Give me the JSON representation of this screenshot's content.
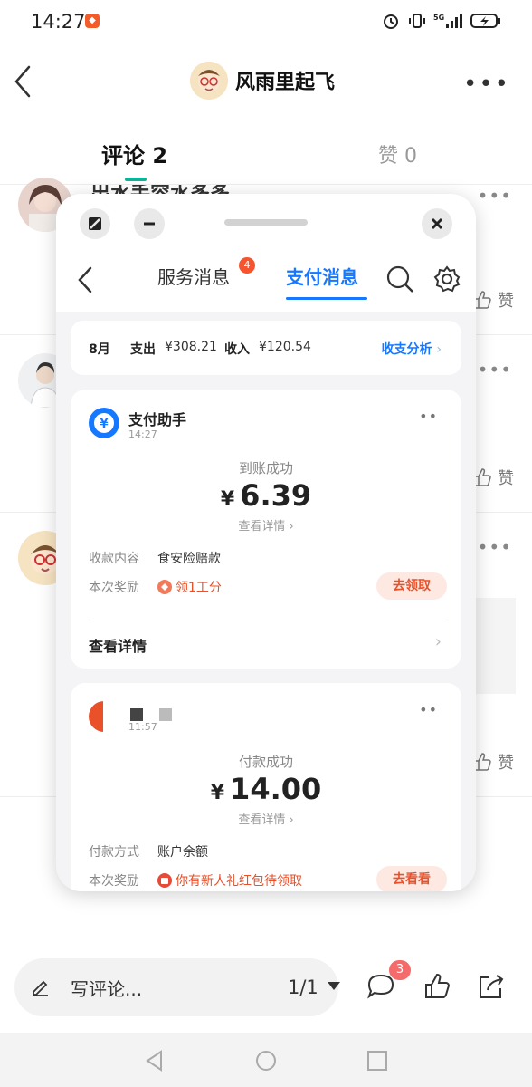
{
  "status_bar": {
    "time": "14:27",
    "network": "5G"
  },
  "header": {
    "author": "风雨里起飞"
  },
  "tabs": {
    "comments": "评论 2",
    "likes": "赞 0"
  },
  "comments": {
    "partial_text": "出水手容水多多",
    "like_label": "赞"
  },
  "bottom_bar": {
    "write_placeholder": "写评论...",
    "page_indicator": "1/1",
    "comment_badge": "3"
  },
  "float_window": {
    "nav": {
      "tab_service": "服务消息",
      "tab_service_badge": "4",
      "tab_payment": "支付消息"
    },
    "summary": {
      "month": "8月",
      "expense_label": "支出",
      "expense_value": "¥308.21",
      "income_label": "收入",
      "income_value": "¥120.54",
      "analysis_link": "收支分析"
    },
    "card1": {
      "source": "支付助手",
      "time": "14:27",
      "status": "到账成功",
      "currency": "¥",
      "amount": "6.39",
      "detail_link": "查看详情",
      "row1_label": "收款内容",
      "row1_value": "食安险赔款",
      "row2_label": "本次奖励",
      "row2_value": "领1工分",
      "action": "去领取",
      "footer": "查看详情"
    },
    "card2": {
      "time": "11:57",
      "status": "付款成功",
      "currency": "¥",
      "amount": "14.00",
      "detail_link": "查看详情",
      "row1_label": "付款方式",
      "row1_value": "账户余额",
      "row2_label": "本次奖励",
      "row2_value": "你有新人礼红包待领取",
      "action": "去看看"
    }
  },
  "colors": {
    "accent_blue": "#1677ff",
    "accent_teal": "#12b19a",
    "accent_orange": "#e8512a"
  }
}
